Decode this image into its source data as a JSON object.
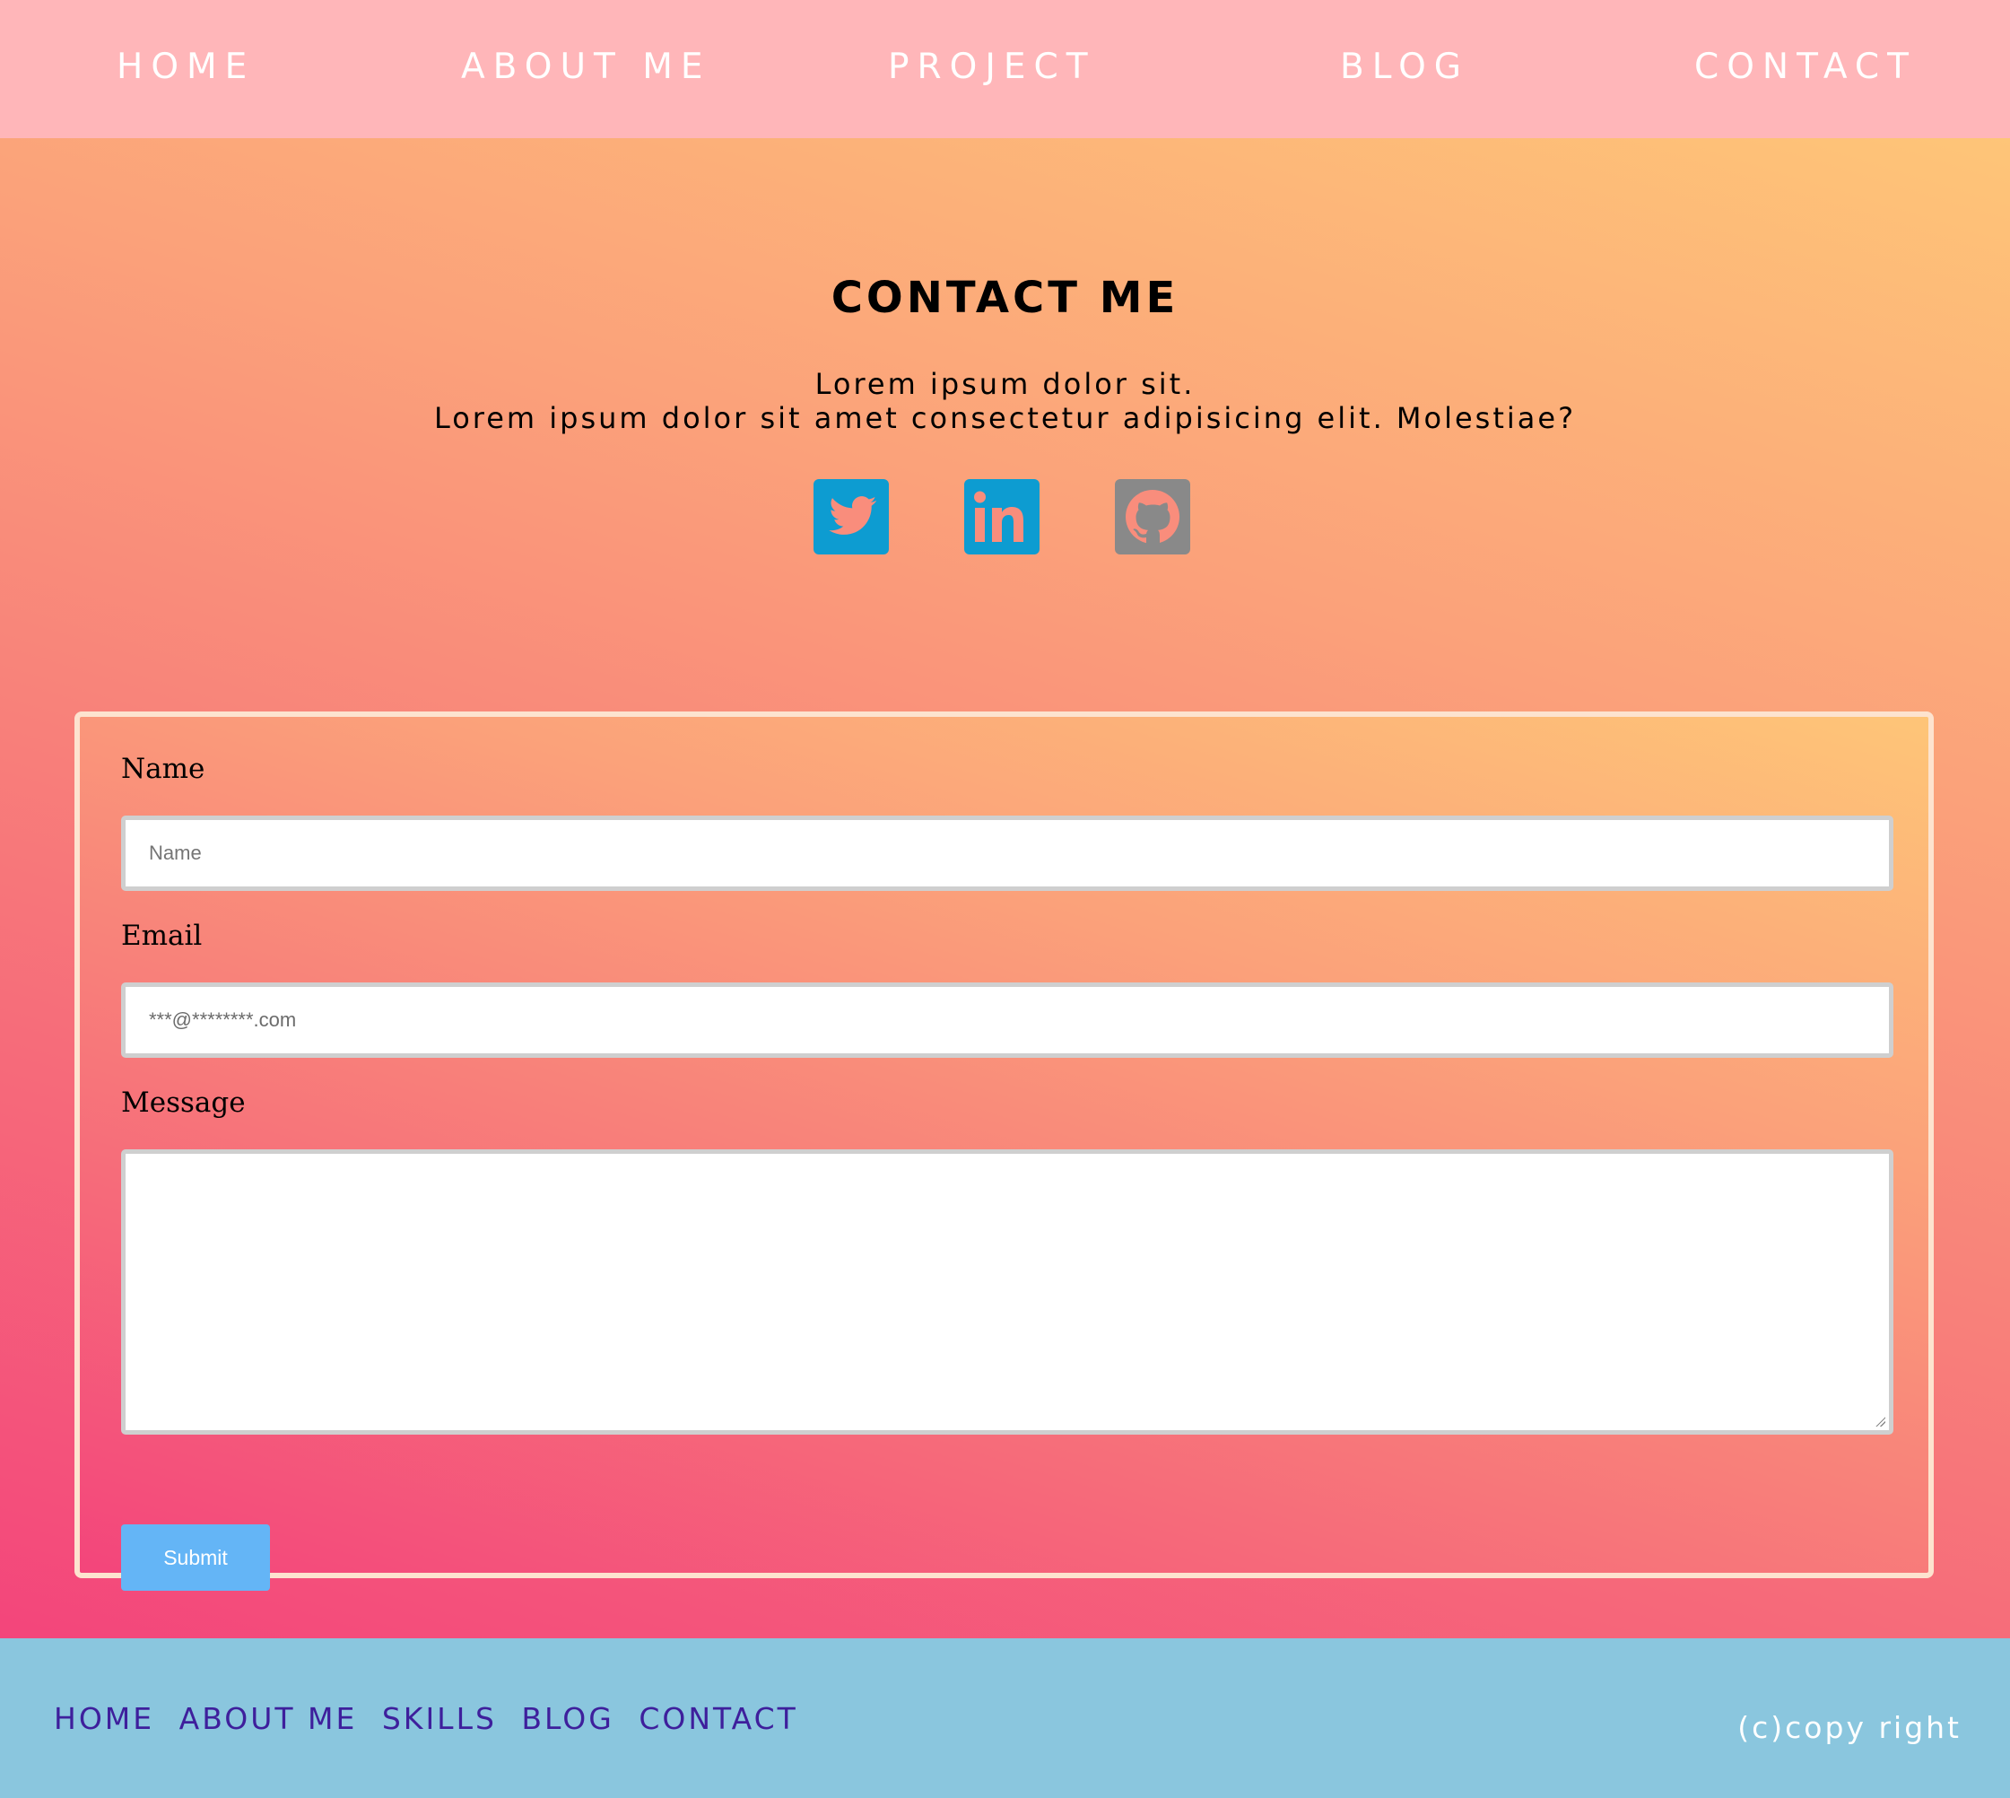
{
  "nav": {
    "items": [
      "HOME",
      "ABOUT ME",
      "PROJECT",
      "BLOG",
      "CONTACT"
    ]
  },
  "hero": {
    "title": "CONTACT ME",
    "intro_line1": "Lorem ipsum dolor sit.",
    "intro_line2": "Lorem ipsum dolor sit amet consectetur adipisicing elit. Molestiae?"
  },
  "social": {
    "icons": [
      "twitter-icon",
      "linkedin-icon",
      "github-icon"
    ],
    "twitter_color": "#0d9cd1",
    "linkedin_color": "#0d9cd1",
    "github_color": "#898989"
  },
  "form": {
    "name_label": "Name",
    "name_placeholder": "Name",
    "email_label": "Email",
    "email_value": "***@********.com",
    "message_label": "Message",
    "message_value": "",
    "submit_label": "Submit"
  },
  "footer": {
    "links": [
      "HOME",
      "ABOUT ME",
      "SKILLS",
      "BLOG",
      "CONTACT"
    ],
    "copyright": "(c)copy right"
  },
  "colors": {
    "nav_bg": "#ffb6b9",
    "gradient_start": "#f3457b",
    "gradient_end": "#fec578",
    "card_border": "#fde3cf",
    "submit_bg": "#64b5f6",
    "footer_bg": "#8ac6de",
    "footer_link": "#3e1f9c"
  }
}
